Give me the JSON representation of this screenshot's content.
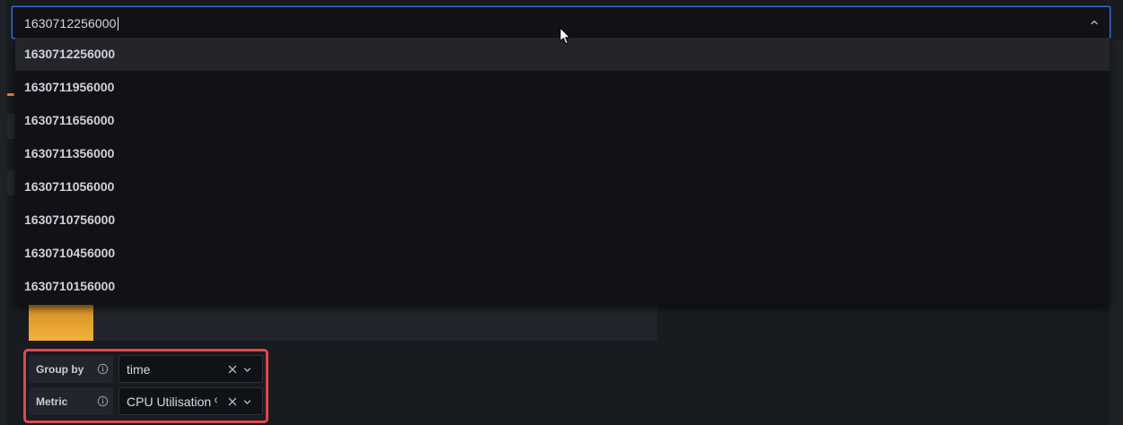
{
  "dropdown": {
    "input_value": "1630712256000",
    "options": [
      "1630712256000",
      "1630711956000",
      "1630711656000",
      "1630711356000",
      "1630711056000",
      "1630710756000",
      "1630710456000",
      "1630710156000"
    ],
    "active_index": 0
  },
  "query": {
    "group_by": {
      "label": "Group by",
      "value": "time"
    },
    "metric": {
      "label": "Metric",
      "value": "CPU Utilisation %"
    }
  },
  "colors": {
    "accent_focus": "#3d71d9",
    "highlight_box": "#e0474a",
    "bar_fill": "#f2b23b"
  },
  "icons": [
    "chevron-up-icon",
    "info-icon",
    "clear-icon",
    "chevron-down-icon",
    "mouse-cursor-icon"
  ]
}
